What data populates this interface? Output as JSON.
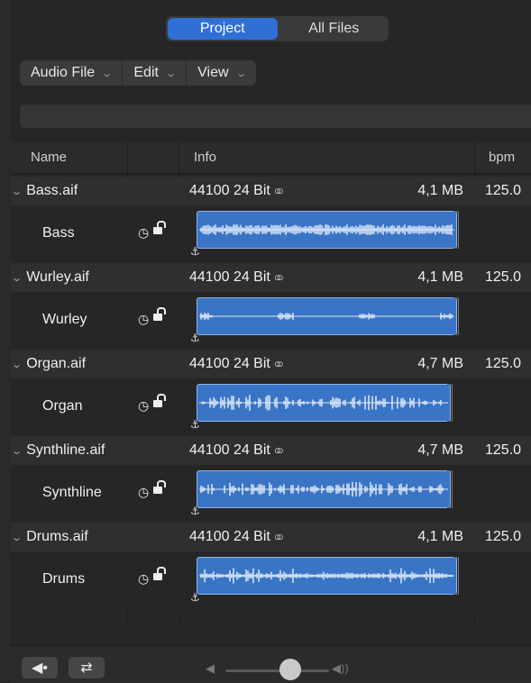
{
  "top_tabs": [
    {
      "label": "Project",
      "active": true
    },
    {
      "label": "All Files",
      "active": false
    }
  ],
  "menus": [
    {
      "label": "Audio File"
    },
    {
      "label": "Edit"
    },
    {
      "label": "View"
    }
  ],
  "columns": {
    "name": "Name",
    "info": "Info",
    "bpm": "bpm"
  },
  "files": [
    {
      "file": "Bass.aif",
      "info": "44100  24 Bit",
      "size": "4,1 MB",
      "bpm": "125.0",
      "region": "Bass"
    },
    {
      "file": "Wurley.aif",
      "info": "44100  24 Bit",
      "size": "4,1 MB",
      "bpm": "125.0",
      "region": "Wurley"
    },
    {
      "file": "Organ.aif",
      "info": "44100  24 Bit",
      "size": "4,7 MB",
      "bpm": "125.0",
      "region": "Organ"
    },
    {
      "file": "Synthline.aif",
      "info": "44100  24 Bit",
      "size": "4,7 MB",
      "bpm": "125.0",
      "region": "Synthline"
    },
    {
      "file": "Drums.aif",
      "info": "44100  24 Bit",
      "size": "4,1 MB",
      "bpm": "125.0",
      "region": "Drums"
    }
  ],
  "icons": {
    "disclosure": "chevron-down-icon",
    "stereo": "stereo-icon",
    "clock": "clock-icon",
    "lock": "lock-open-icon",
    "anchor": "anchor-icon",
    "preview": "speaker-icon",
    "loop": "loop-icon",
    "volume_low": "volume-low-icon",
    "volume_high": "volume-high-icon"
  },
  "glyphs": {
    "stereo": "○○",
    "clock": "◷",
    "anchor": "⚓",
    "chevron": "⌄"
  },
  "volume_level": 0.6,
  "colors": {
    "accent": "#2f6fd6",
    "region": "#3a74c4"
  }
}
